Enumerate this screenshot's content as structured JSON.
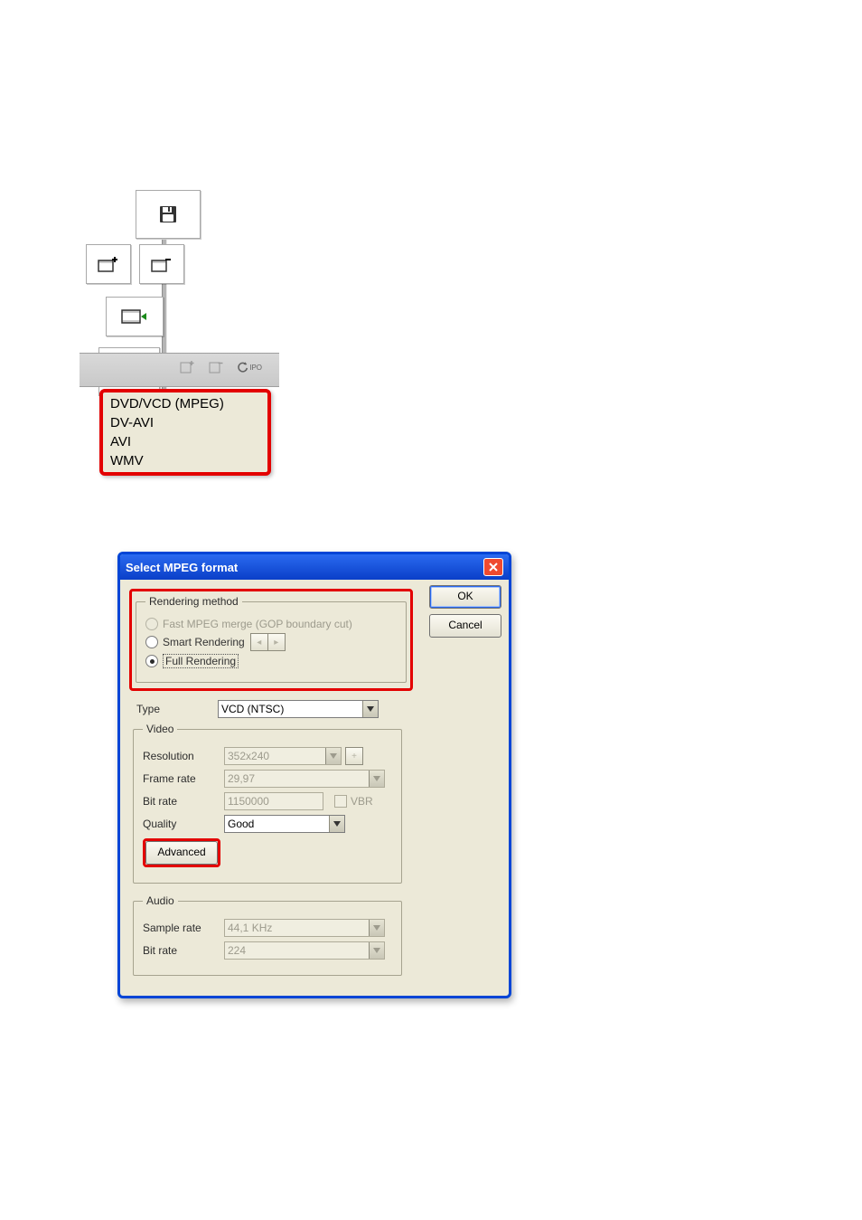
{
  "top": {
    "icons": {
      "save1": "save-icon",
      "clip_add": "clip-add-icon",
      "clip_remove": "clip-remove-icon",
      "clip_play": "clip-play-icon",
      "save2": "save-icon",
      "kf_add": "keyframe-add-icon",
      "kf_remove": "keyframe-remove-icon",
      "ipo_reset": "reset-ipo-icon",
      "ipo_label": "IPO"
    },
    "menu": [
      "DVD/VCD (MPEG)",
      "DV-AVI",
      "AVI",
      "WMV"
    ]
  },
  "dialog": {
    "title": "Select MPEG format",
    "buttons": {
      "ok": "OK",
      "cancel": "Cancel"
    },
    "rendering": {
      "legend": "Rendering method",
      "gop": "Fast MPEG merge (GOP boundary cut)",
      "smart": "Smart Rendering",
      "full": "Full Rendering"
    },
    "type": {
      "label": "Type",
      "value": "VCD (NTSC)"
    },
    "video": {
      "legend": "Video",
      "resolution": {
        "label": "Resolution",
        "value": "352x240"
      },
      "frame_rate": {
        "label": "Frame rate",
        "value": "29,97"
      },
      "bit_rate": {
        "label": "Bit rate",
        "value": "1150000"
      },
      "vbr": {
        "label": "VBR"
      },
      "quality": {
        "label": "Quality",
        "value": "Good"
      },
      "advanced": "Advanced"
    },
    "audio": {
      "legend": "Audio",
      "sample_rate": {
        "label": "Sample rate",
        "value": "44,1 KHz"
      },
      "bit_rate": {
        "label": "Bit rate",
        "value": "224"
      }
    }
  }
}
